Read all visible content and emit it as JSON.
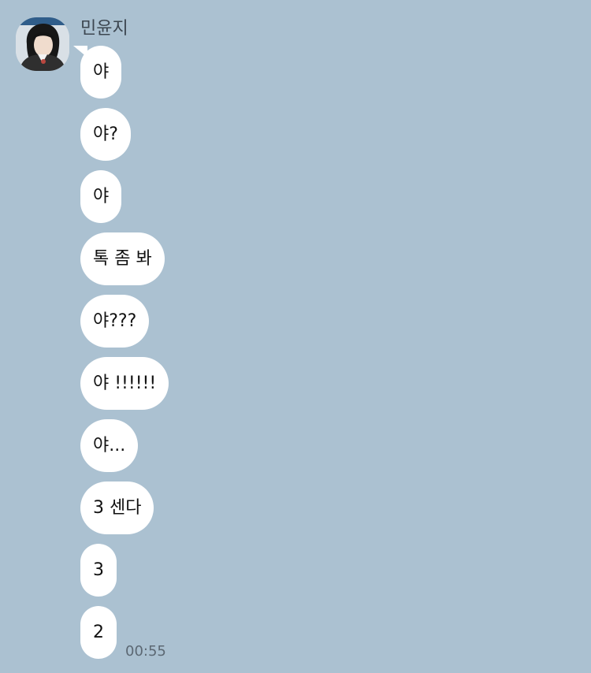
{
  "chat": {
    "sender": {
      "name": "민윤지",
      "avatar_icon": "profile-photo"
    },
    "messages": [
      {
        "text": "야"
      },
      {
        "text": "야?"
      },
      {
        "text": "야"
      },
      {
        "text": "톡 좀 봐"
      },
      {
        "text": "야???"
      },
      {
        "text": "야 !!!!!!"
      },
      {
        "text": "야..."
      },
      {
        "text": "3 센다"
      },
      {
        "text": "3"
      },
      {
        "text": "2",
        "time": "00:55"
      }
    ]
  },
  "colors": {
    "background": "#abc1d1",
    "bubble": "#ffffff",
    "timestamp": "#5c6873"
  }
}
